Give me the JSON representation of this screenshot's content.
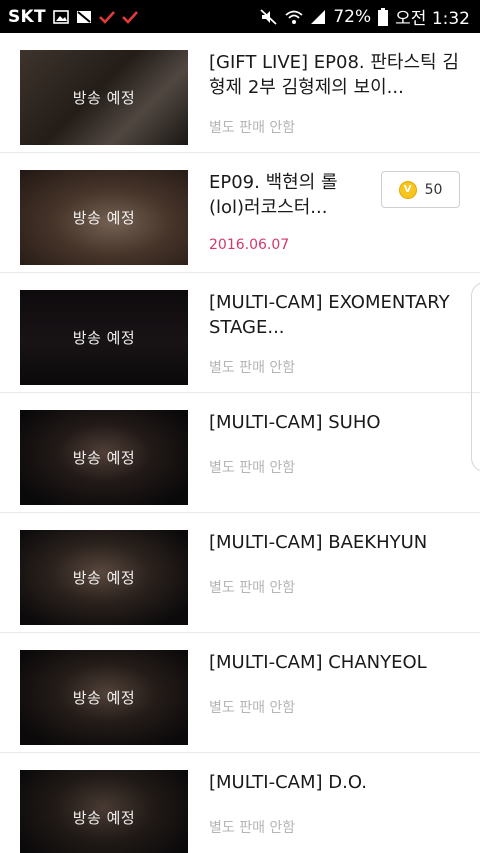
{
  "status_bar": {
    "carrier": "SKT",
    "battery_percent": "72%",
    "time": "오전 1:32",
    "icons": [
      "gallery-icon",
      "image-crossed-icon",
      "check-icon",
      "check-icon",
      "mute-icon",
      "wifi-icon",
      "signal-icon",
      "battery-icon"
    ]
  },
  "items": [
    {
      "title": "[GIFT LIVE] EP08. 판타스틱 김형제 2부 김형제의 보이...",
      "thumb_label": "방송 예정",
      "sub": "별도 판매 안함"
    },
    {
      "title": "EP09. 백현의 롤(lol)러코스터...",
      "thumb_label": "방송 예정",
      "sub": "2016.06.07",
      "price": "50",
      "coin_symbol": "V"
    },
    {
      "title": "[MULTI-CAM] EXOMENTARY STAGE...",
      "thumb_label": "방송 예정",
      "sub": "별도 판매 안함"
    },
    {
      "title": "[MULTI-CAM] SUHO",
      "thumb_label": "방송 예정",
      "sub": "별도 판매 안함"
    },
    {
      "title": "[MULTI-CAM] BAEKHYUN",
      "thumb_label": "방송 예정",
      "sub": "별도 판매 안함"
    },
    {
      "title": "[MULTI-CAM] CHANYEOL",
      "thumb_label": "방송 예정",
      "sub": "별도 판매 안함"
    },
    {
      "title": "[MULTI-CAM] D.O.",
      "thumb_label": "방송 예정",
      "sub": "별도 판매 안함"
    }
  ],
  "colors": {
    "date_accent": "#d2386f",
    "coin": "#f7c51e",
    "check": "#e23a3a"
  }
}
